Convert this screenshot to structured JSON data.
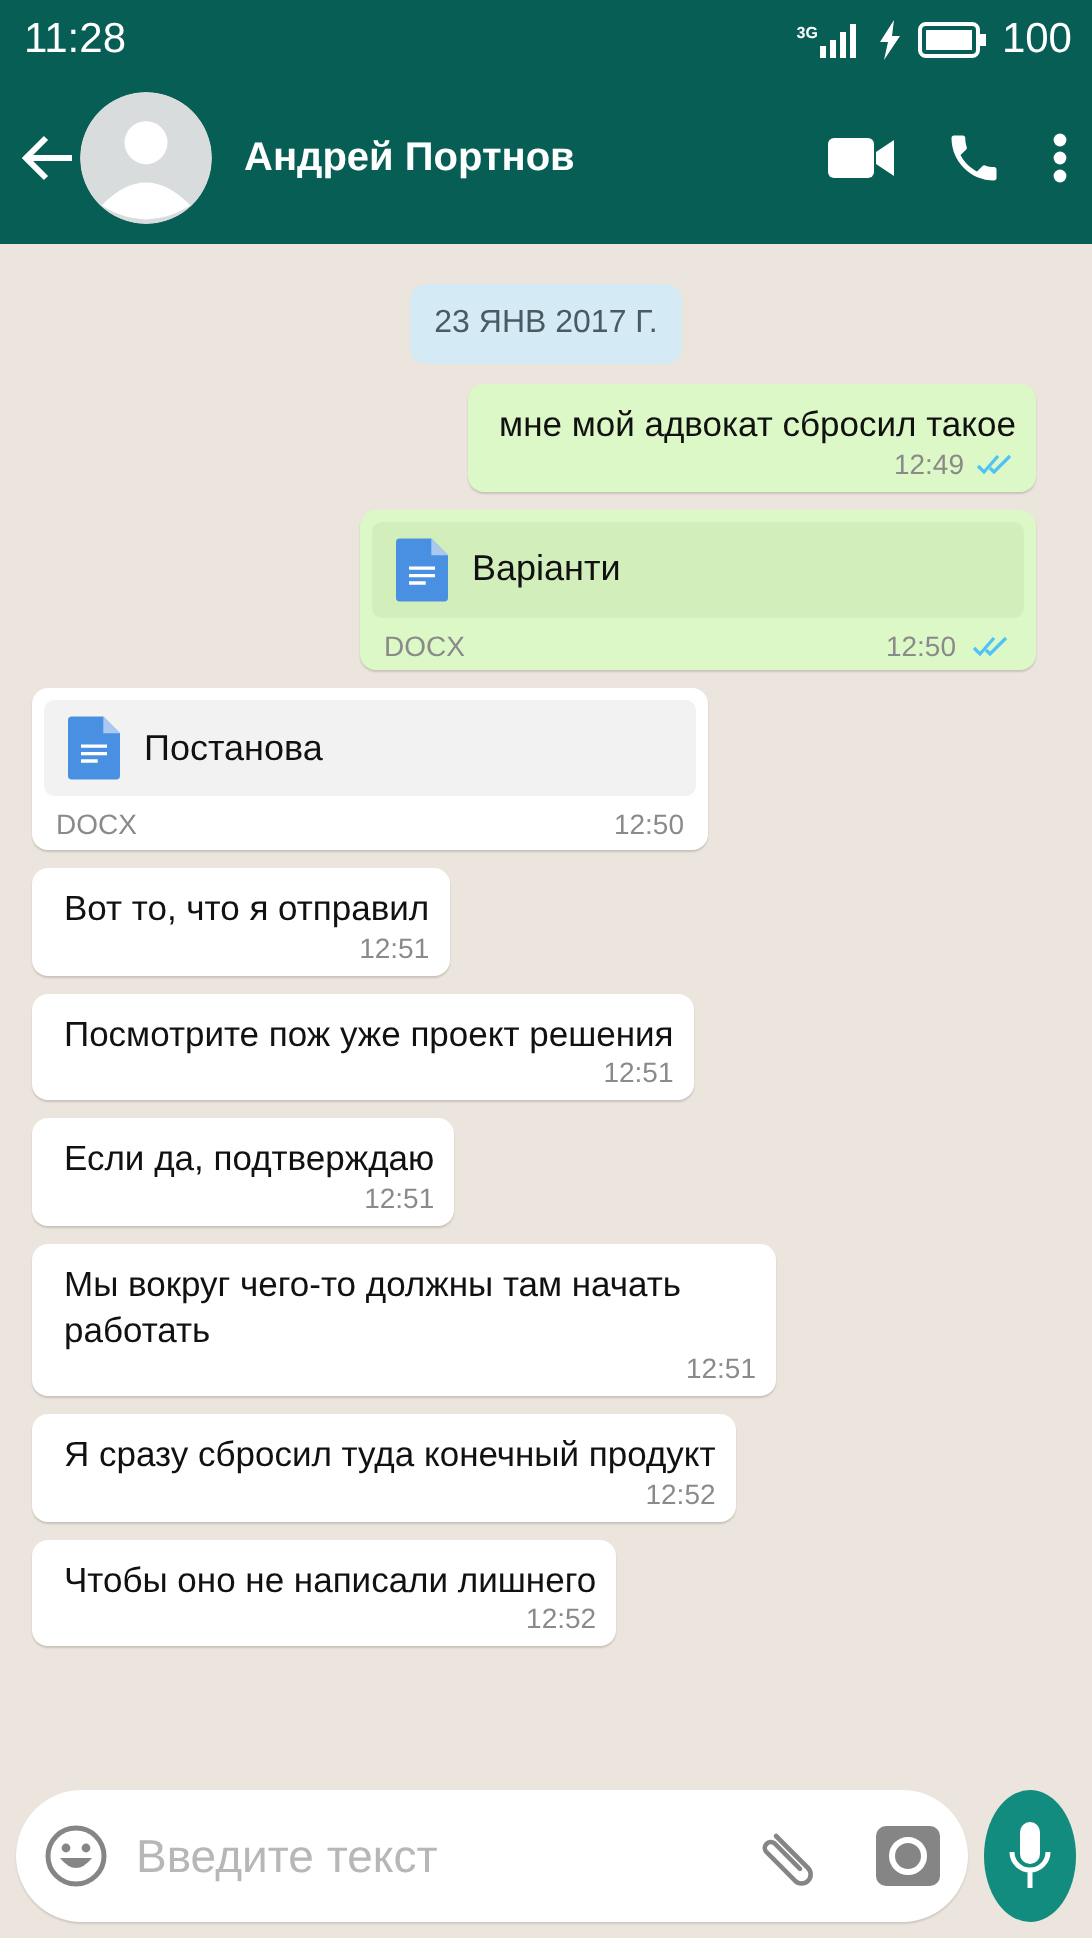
{
  "status_bar": {
    "time": "11:28",
    "network": "3G",
    "battery": "100"
  },
  "header": {
    "contact_name": "Андрей Портнов"
  },
  "date_chip": "23 ЯНВ 2017 Г.",
  "messages": [
    {
      "kind": "text",
      "outgoing": true,
      "read": true,
      "text": "мне мой адвокат сбросил такое",
      "time": "12:49"
    },
    {
      "kind": "document",
      "outgoing": true,
      "read": true,
      "file_name": "Варіанти",
      "file_type": "DOCX",
      "time": "12:50"
    },
    {
      "kind": "document",
      "outgoing": false,
      "read": false,
      "file_name": "Постанова",
      "file_type": "DOCX",
      "time": "12:50"
    },
    {
      "kind": "text",
      "outgoing": false,
      "read": false,
      "text": "Вот то, что я отправил",
      "time": "12:51"
    },
    {
      "kind": "text",
      "outgoing": false,
      "read": false,
      "text": "Посмотрите пож уже проект решения",
      "time": "12:51"
    },
    {
      "kind": "text",
      "outgoing": false,
      "read": false,
      "text": "Если да, подтверждаю",
      "time": "12:51"
    },
    {
      "kind": "text",
      "outgoing": false,
      "read": false,
      "text": "Мы вокруг чего-то должны там начать работать",
      "time": "12:51"
    },
    {
      "kind": "text",
      "outgoing": false,
      "read": false,
      "text": "Я сразу сбросил туда конечный продукт",
      "time": "12:52"
    },
    {
      "kind": "text",
      "outgoing": false,
      "read": false,
      "text": "Чтобы оно не написали лишнего",
      "time": "12:52"
    }
  ],
  "composer": {
    "placeholder": "Введите текст"
  }
}
